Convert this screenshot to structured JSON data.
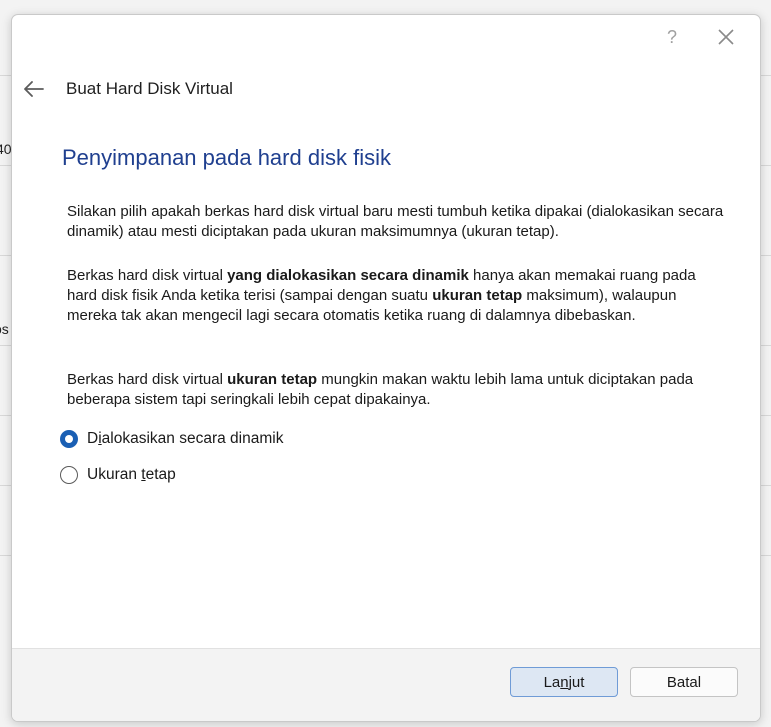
{
  "window": {
    "help_label": "?",
    "close_icon": "close-icon",
    "back_icon": "arrow-left-icon"
  },
  "background": {
    "frag_1": "40",
    "frag_2": "os"
  },
  "wizard": {
    "title": "Buat Hard Disk Virtual",
    "heading": "Penyimpanan pada hard disk fisik",
    "para1": "Silakan pilih apakah berkas hard disk virtual baru mesti tumbuh ketika dipakai (dialokasikan secara dinamik) atau mesti diciptakan pada ukuran maksimumnya (ukuran tetap).",
    "para2": {
      "p1": "Berkas hard disk virtual ",
      "b1": "yang dialokasikan secara dinamik",
      "p2": " hanya akan memakai ruang pada hard disk fisik Anda ketika terisi (sampai dengan suatu ",
      "b2": "ukuran tetap",
      "p3": " maksimum), walaupun mereka tak akan mengecil lagi secara otomatis ketika ruang di dalamnya dibebaskan."
    },
    "para3": {
      "p1": "Berkas hard disk virtual ",
      "b1": "ukuran tetap",
      "p2": " mungkin makan waktu lebih lama untuk diciptakan pada beberapa sistem tapi seringkali lebih cepat dipakainya."
    },
    "options": {
      "dynamic": {
        "pre": "D",
        "mnemonic": "i",
        "post": "alokasikan secara dinamik",
        "selected": true
      },
      "fixed": {
        "pre": "Ukuran ",
        "mnemonic": "t",
        "post": "etap",
        "selected": false
      }
    }
  },
  "footer": {
    "next": {
      "pre": "La",
      "mnemonic": "n",
      "post": "jut"
    },
    "cancel": "Batal"
  },
  "colors": {
    "accent": "#1a5fb4",
    "heading": "#1f3f8f",
    "next_button_bg": "#dde7f3"
  }
}
